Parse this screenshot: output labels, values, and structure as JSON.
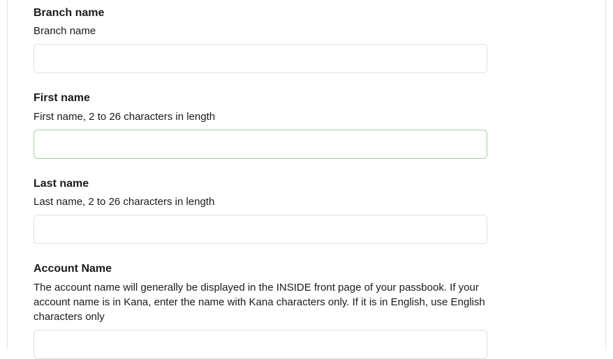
{
  "form": {
    "branch": {
      "label": "Branch name",
      "help": "Branch name",
      "value": ""
    },
    "first_name": {
      "label": "First name",
      "help": "First name, 2 to 26 characters in length",
      "value": ""
    },
    "last_name": {
      "label": "Last name",
      "help": "Last name, 2 to 26 characters in length",
      "value": ""
    },
    "account_name": {
      "label": "Account Name",
      "help": "The account name will generally be displayed in the INSIDE front page of your passbook. If your account name is in Kana, enter the name with Kana characters only. If it is in English, use English characters only",
      "value": ""
    }
  }
}
